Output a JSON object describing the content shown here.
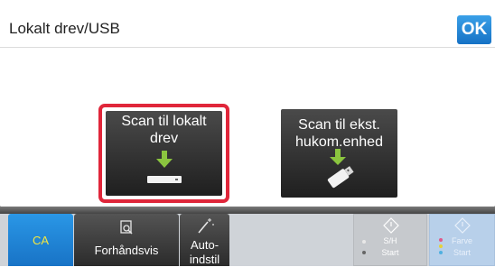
{
  "header": {
    "title": "Lokalt drev/USB",
    "ok_label": "OK"
  },
  "options": [
    {
      "label": "Scan til lokalt drev",
      "selected": true,
      "icon": "local-drive-icon"
    },
    {
      "label_line1": "Scan til ekst.",
      "label_line2": "hukom.enhed",
      "selected": false,
      "icon": "usb-drive-icon"
    }
  ],
  "bottom_bar": {
    "ca_label": "CA",
    "preview_label": "Forhåndsvis",
    "auto_label_line1": "Auto-",
    "auto_label_line2": "indstil",
    "mono_start_line1": "S/H",
    "mono_start_line2": "Start",
    "color_start_line1": "Farve",
    "color_start_line2": "Start"
  },
  "colors": {
    "accent_blue": "#1a7fd4",
    "selection_red": "#e0263a",
    "arrow_green": "#8bc53f",
    "ca_text_yellow": "#f5e640"
  }
}
